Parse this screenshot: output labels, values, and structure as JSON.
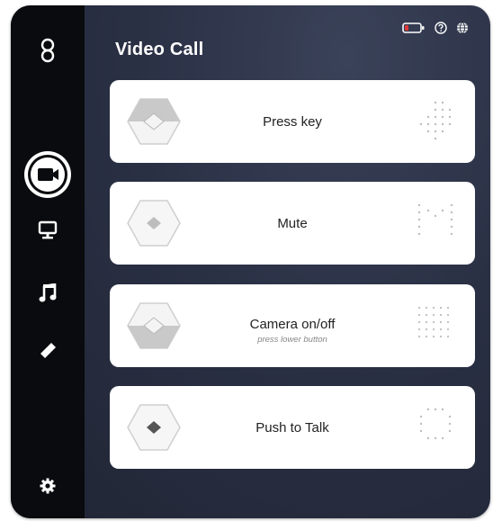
{
  "window": {
    "title": "Video Call"
  },
  "status_icons": [
    "battery-icon",
    "help-icon",
    "globe-icon"
  ],
  "sidebar": {
    "items": [
      {
        "name": "logo-icon"
      },
      {
        "name": "video-camera-icon",
        "active": true
      },
      {
        "name": "monitor-icon"
      },
      {
        "name": "music-note-icon"
      },
      {
        "name": "pencil-icon"
      },
      {
        "name": "gear-icon"
      }
    ]
  },
  "actions": [
    {
      "label": "Press key",
      "sublabel": ""
    },
    {
      "label": "Mute",
      "sublabel": ""
    },
    {
      "label": "Camera on/off",
      "sublabel": "press lower button"
    },
    {
      "label": "Push to Talk",
      "sublabel": ""
    }
  ],
  "colors": {
    "battery_low": "#e03838",
    "accent": "#ffffff"
  }
}
